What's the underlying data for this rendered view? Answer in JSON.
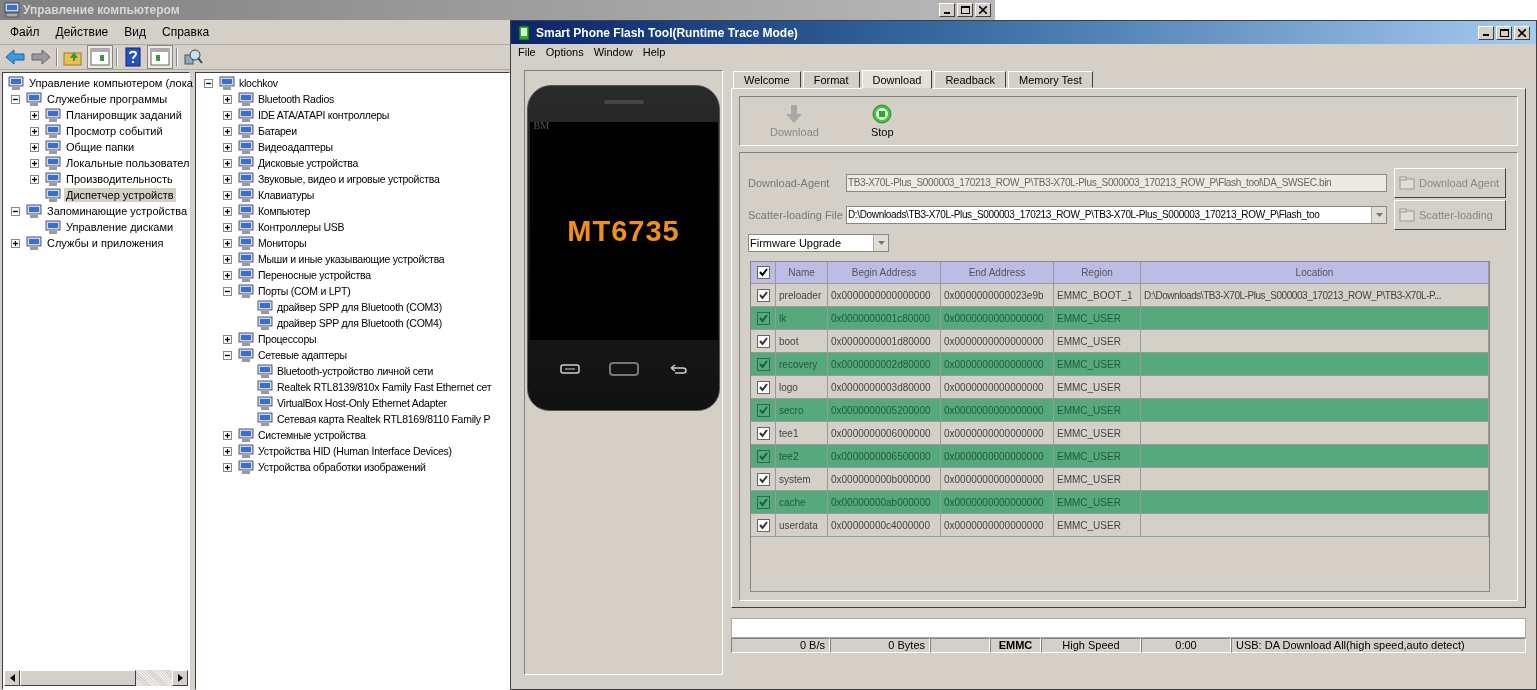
{
  "management_window": {
    "title": "Управление компьютером",
    "menu": [
      "Файл",
      "Действие",
      "Вид",
      "Справка"
    ],
    "navigation": [
      {
        "label": "Управление компьютером (лока",
        "selected": false,
        "children": [
          {
            "label": "Служебные программы",
            "expanded": true,
            "selected": false,
            "children": [
              {
                "label": "Планировщик заданий",
                "expanded": false,
                "selected": false
              },
              {
                "label": "Просмотр событий",
                "expanded": false,
                "selected": false
              },
              {
                "label": "Общие папки",
                "expanded": false,
                "selected": false
              },
              {
                "label": "Локальные пользовател",
                "expanded": false,
                "selected": false
              },
              {
                "label": "Производительность",
                "expanded": false,
                "selected": false
              },
              {
                "label": "Диспетчер устройств",
                "selected": true
              }
            ]
          },
          {
            "label": "Запоминающие устройства",
            "expanded": true,
            "selected": false,
            "children": [
              {
                "label": "Управление дисками",
                "selected": false
              }
            ]
          },
          {
            "label": "Службы и приложения",
            "expanded": false,
            "selected": false
          }
        ]
      }
    ],
    "device_tree": [
      {
        "label": "klochkov",
        "expanded": true,
        "children": [
          {
            "label": "Bluetooth Radios",
            "expanded": false
          },
          {
            "label": "IDE ATA/ATAPI контроллеры",
            "expanded": false
          },
          {
            "label": "Батареи",
            "expanded": false
          },
          {
            "label": "Видеоадаптеры",
            "expanded": false
          },
          {
            "label": "Дисковые устройства",
            "expanded": false
          },
          {
            "label": "Звуковые, видео и игровые устройства",
            "expanded": false
          },
          {
            "label": "Клавиатуры",
            "expanded": false
          },
          {
            "label": "Компьютер",
            "expanded": false
          },
          {
            "label": "Контроллеры USB",
            "expanded": false
          },
          {
            "label": "Мониторы",
            "expanded": false
          },
          {
            "label": "Мыши и иные указывающие устройства",
            "expanded": false
          },
          {
            "label": "Переносные устройства",
            "expanded": false
          },
          {
            "label": "Порты (COM и LPT)",
            "expanded": true,
            "children": [
              {
                "label": "драйвер SPP для Bluetooth (COM3)"
              },
              {
                "label": "драйвер SPP для Bluetooth (COM4)"
              }
            ]
          },
          {
            "label": "Процессоры",
            "expanded": false
          },
          {
            "label": "Сетевые адаптеры",
            "expanded": true,
            "children": [
              {
                "label": "Bluetooth-устройство личной сети"
              },
              {
                "label": "Realtek RTL8139/810x Family Fast Ethernet сет"
              },
              {
                "label": "VirtualBox Host-Only Ethernet Adapter"
              },
              {
                "label": "Сетевая карта Realtek RTL8169/8110 Family P"
              }
            ]
          },
          {
            "label": "Системные устройства",
            "expanded": false
          },
          {
            "label": "Устройства HID (Human Interface Devices)",
            "expanded": false
          },
          {
            "label": "Устройства обработки изображений",
            "expanded": false
          }
        ]
      }
    ]
  },
  "flash_window": {
    "title": "Smart Phone Flash Tool(Runtime Trace Mode)",
    "menu": [
      "File",
      "Options",
      "Window",
      "Help"
    ],
    "phone": {
      "brand": "BM",
      "chip": "MT6735"
    },
    "tabs": [
      {
        "label": "Welcome",
        "selected": false
      },
      {
        "label": "Format",
        "selected": false
      },
      {
        "label": "Download",
        "selected": true
      },
      {
        "label": "Readback",
        "selected": false
      },
      {
        "label": "Memory Test",
        "selected": false
      }
    ],
    "actions": [
      {
        "label": "Download",
        "kind": "download",
        "disabled": true
      },
      {
        "label": "Stop",
        "kind": "stop",
        "disabled": false
      }
    ],
    "download_agent": {
      "label": "Download-Agent",
      "value": "TB3-X70L-Plus_S000003_170213_ROW_P\\TB3-X70L-Plus_S000003_170213_ROW_P\\Flash_tool\\DA_SWSEC.bin",
      "disabled": true,
      "button": "Download Agent"
    },
    "scatter_file": {
      "label": "Scatter-loading File",
      "value": "D:\\Downloads\\TB3-X70L-Plus_S000003_170213_ROW_P\\TB3-X70L-Plus_S000003_170213_ROW_P\\Flash_too",
      "disabled": false,
      "button": "Scatter-loading"
    },
    "mode": "Firmware Upgrade",
    "table": {
      "all_checked": true,
      "columns": [
        "Name",
        "Begin Address",
        "End Address",
        "Region",
        "Location"
      ],
      "rows": [
        {
          "checked": true,
          "highlighted": false,
          "name": "preloader",
          "begin": "0x0000000000000000",
          "end": "0x0000000000023e9b",
          "region": "EMMC_BOOT_1",
          "location": "D:\\Downloads\\TB3-X70L-Plus_S000003_170213_ROW_P\\TB3-X70L-P..."
        },
        {
          "checked": true,
          "highlighted": true,
          "name": "lk",
          "begin": "0x0000000001c80000",
          "end": "0x0000000000000000",
          "region": "EMMC_USER"
        },
        {
          "checked": true,
          "highlighted": false,
          "name": "boot",
          "begin": "0x0000000001d80000",
          "end": "0x0000000000000000",
          "region": "EMMC_USER"
        },
        {
          "checked": true,
          "highlighted": true,
          "name": "recovery",
          "begin": "0x0000000002d80000",
          "end": "0x0000000000000000",
          "region": "EMMC_USER"
        },
        {
          "checked": true,
          "highlighted": false,
          "name": "logo",
          "begin": "0x0000000003d80000",
          "end": "0x0000000000000000",
          "region": "EMMC_USER"
        },
        {
          "checked": true,
          "highlighted": true,
          "name": "secro",
          "begin": "0x0000000005200000",
          "end": "0x0000000000000000",
          "region": "EMMC_USER"
        },
        {
          "checked": true,
          "highlighted": false,
          "name": "tee1",
          "begin": "0x0000000006000000",
          "end": "0x0000000000000000",
          "region": "EMMC_USER"
        },
        {
          "checked": true,
          "highlighted": true,
          "name": "tee2",
          "begin": "0x0000000006500000",
          "end": "0x0000000000000000",
          "region": "EMMC_USER"
        },
        {
          "checked": true,
          "highlighted": false,
          "name": "system",
          "begin": "0x000000000b000000",
          "end": "0x0000000000000000",
          "region": "EMMC_USER"
        },
        {
          "checked": true,
          "highlighted": true,
          "name": "cache",
          "begin": "0x00000000ab000000",
          "end": "0x0000000000000000",
          "region": "EMMC_USER"
        },
        {
          "checked": true,
          "highlighted": false,
          "name": "userdata",
          "begin": "0x00000000c4000000",
          "end": "0x0000000000000000",
          "region": "EMMC_USER"
        }
      ]
    },
    "progress": {
      "level": 0
    },
    "status": {
      "speed": "0 B/s",
      "bytes": "0 Bytes",
      "storage": "EMMC",
      "link": "High Speed",
      "time": "0:00",
      "message": "USB: DA Download All(high speed,auto detect)"
    }
  }
}
